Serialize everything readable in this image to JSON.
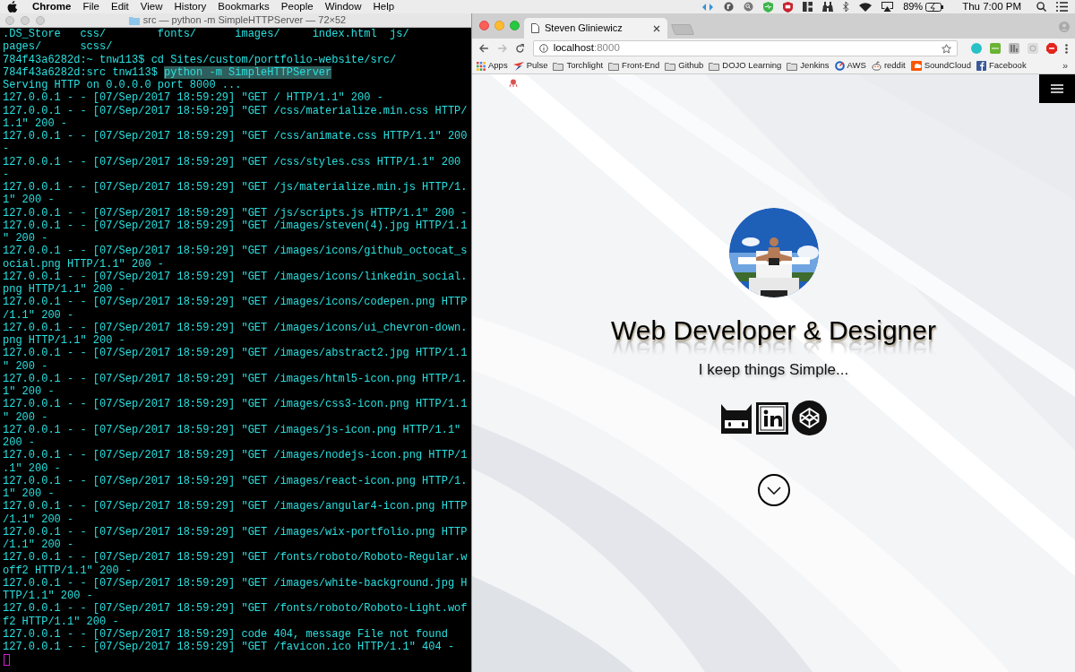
{
  "menu_bar": {
    "app_name": "Chrome",
    "menus": [
      "File",
      "Edit",
      "View",
      "History",
      "Bookmarks",
      "People",
      "Window",
      "Help"
    ],
    "battery": "89%",
    "clock": "Thu 7:00 PM"
  },
  "terminal": {
    "title": "src — python -m SimpleHTTPServer — 72×52",
    "lines": [
      {
        "text": ".DS_Store   css/        fonts/      images/     index.html  js/"
      },
      {
        "text": "pages/      scss/"
      },
      {
        "text": "784f43a6282d:~ tnw113$ cd Sites/custom/portfolio-website/src/"
      },
      {
        "text": "784f43a6282d:src tnw113$ ",
        "selected_text": "python -m SimpleHTTPServer"
      },
      {
        "text": "Serving HTTP on 0.0.0.0 port 8000 ..."
      },
      {
        "text": "127.0.0.1 - - [07/Sep/2017 18:59:29] \"GET / HTTP/1.1\" 200 -"
      },
      {
        "text": "127.0.0.1 - - [07/Sep/2017 18:59:29] \"GET /css/materialize.min.css HTTP/"
      },
      {
        "text": "1.1\" 200 -"
      },
      {
        "text": "127.0.0.1 - - [07/Sep/2017 18:59:29] \"GET /css/animate.css HTTP/1.1\" 200"
      },
      {
        "text": "-"
      },
      {
        "text": "127.0.0.1 - - [07/Sep/2017 18:59:29] \"GET /css/styles.css HTTP/1.1\" 200"
      },
      {
        "text": "-"
      },
      {
        "text": "127.0.0.1 - - [07/Sep/2017 18:59:29] \"GET /js/materialize.min.js HTTP/1."
      },
      {
        "text": "1\" 200 -"
      },
      {
        "text": "127.0.0.1 - - [07/Sep/2017 18:59:29] \"GET /js/scripts.js HTTP/1.1\" 200 -"
      },
      {
        "text": "127.0.0.1 - - [07/Sep/2017 18:59:29] \"GET /images/steven(4).jpg HTTP/1.1"
      },
      {
        "text": "\" 200 -"
      },
      {
        "text": "127.0.0.1 - - [07/Sep/2017 18:59:29] \"GET /images/icons/github_octocat_s"
      },
      {
        "text": "ocial.png HTTP/1.1\" 200 -"
      },
      {
        "text": "127.0.0.1 - - [07/Sep/2017 18:59:29] \"GET /images/icons/linkedin_social."
      },
      {
        "text": "png HTTP/1.1\" 200 -"
      },
      {
        "text": "127.0.0.1 - - [07/Sep/2017 18:59:29] \"GET /images/icons/codepen.png HTTP"
      },
      {
        "text": "/1.1\" 200 -"
      },
      {
        "text": "127.0.0.1 - - [07/Sep/2017 18:59:29] \"GET /images/icons/ui_chevron-down."
      },
      {
        "text": "png HTTP/1.1\" 200 -"
      },
      {
        "text": "127.0.0.1 - - [07/Sep/2017 18:59:29] \"GET /images/abstract2.jpg HTTP/1.1"
      },
      {
        "text": "\" 200 -"
      },
      {
        "text": "127.0.0.1 - - [07/Sep/2017 18:59:29] \"GET /images/html5-icon.png HTTP/1."
      },
      {
        "text": "1\" 200 -"
      },
      {
        "text": "127.0.0.1 - - [07/Sep/2017 18:59:29] \"GET /images/css3-icon.png HTTP/1.1"
      },
      {
        "text": "\" 200 -"
      },
      {
        "text": "127.0.0.1 - - [07/Sep/2017 18:59:29] \"GET /images/js-icon.png HTTP/1.1\""
      },
      {
        "text": "200 -"
      },
      {
        "text": "127.0.0.1 - - [07/Sep/2017 18:59:29] \"GET /images/nodejs-icon.png HTTP/1"
      },
      {
        "text": ".1\" 200 -"
      },
      {
        "text": "127.0.0.1 - - [07/Sep/2017 18:59:29] \"GET /images/react-icon.png HTTP/1."
      },
      {
        "text": "1\" 200 -"
      },
      {
        "text": "127.0.0.1 - - [07/Sep/2017 18:59:29] \"GET /images/angular4-icon.png HTTP"
      },
      {
        "text": "/1.1\" 200 -"
      },
      {
        "text": "127.0.0.1 - - [07/Sep/2017 18:59:29] \"GET /images/wix-portfolio.png HTTP"
      },
      {
        "text": "/1.1\" 200 -"
      },
      {
        "text": "127.0.0.1 - - [07/Sep/2017 18:59:29] \"GET /fonts/roboto/Roboto-Regular.w"
      },
      {
        "text": "off2 HTTP/1.1\" 200 -"
      },
      {
        "text": "127.0.0.1 - - [07/Sep/2017 18:59:29] \"GET /images/white-background.jpg H"
      },
      {
        "text": "TTP/1.1\" 200 -"
      },
      {
        "text": "127.0.0.1 - - [07/Sep/2017 18:59:29] \"GET /fonts/roboto/Roboto-Light.wof"
      },
      {
        "text": "f2 HTTP/1.1\" 200 -"
      },
      {
        "text": "127.0.0.1 - - [07/Sep/2017 18:59:29] code 404, message File not found"
      },
      {
        "text": "127.0.0.1 - - [07/Sep/2017 18:59:29] \"GET /favicon.ico HTTP/1.1\" 404 -"
      }
    ]
  },
  "browser": {
    "tab_title": "Steven Gliniewicz",
    "url": {
      "host": "localhost",
      "port": ":8000"
    },
    "bookmarks": [
      {
        "label": "Apps",
        "kind": "apps"
      },
      {
        "label": "Pulse",
        "kind": "pulse"
      },
      {
        "label": "Torchlight",
        "kind": "folder"
      },
      {
        "label": "Front-End",
        "kind": "folder"
      },
      {
        "label": "Github",
        "kind": "folder"
      },
      {
        "label": "DOJO Learning",
        "kind": "folder"
      },
      {
        "label": "Jenkins",
        "kind": "folder"
      },
      {
        "label": "AWS",
        "kind": "ring"
      },
      {
        "label": "reddit",
        "kind": "alien"
      },
      {
        "label": "SoundCloud",
        "kind": "cloud"
      },
      {
        "label": "Facebook",
        "kind": "square"
      }
    ],
    "bookmarks_more": "»"
  },
  "page": {
    "heading": "Web Developer & Designer",
    "tagline": "I keep things Simple...",
    "social_links": [
      {
        "kind": "cat"
      },
      {
        "kind": "linkedin"
      },
      {
        "kind": "cube"
      }
    ]
  }
}
